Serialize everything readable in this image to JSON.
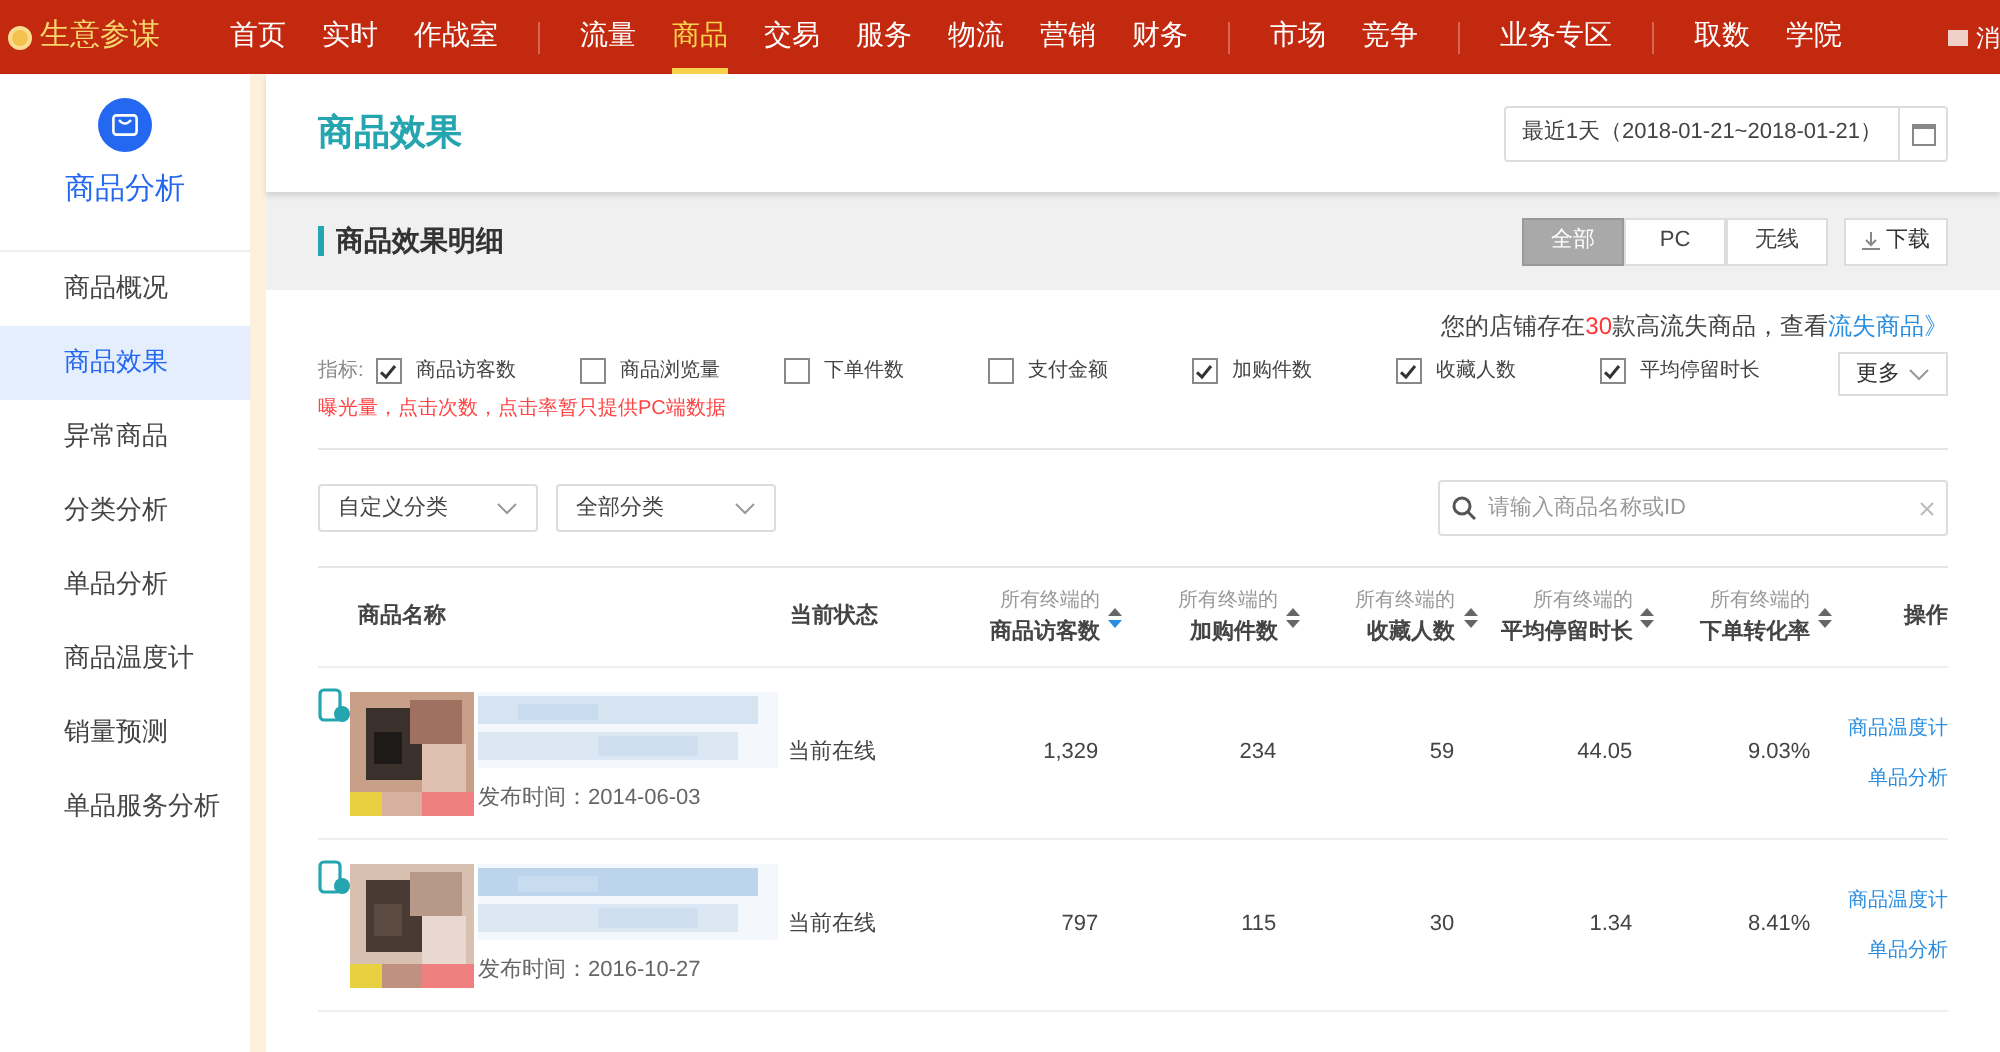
{
  "topnav": {
    "brand": "生意参谋",
    "groups": [
      [
        {
          "label": "首页",
          "selected": false
        },
        {
          "label": "实时",
          "selected": false
        },
        {
          "label": "作战室",
          "selected": false
        }
      ],
      [
        {
          "label": "流量",
          "selected": false
        },
        {
          "label": "商品",
          "selected": true
        },
        {
          "label": "交易",
          "selected": false
        },
        {
          "label": "服务",
          "selected": false
        },
        {
          "label": "物流",
          "selected": false
        },
        {
          "label": "营销",
          "selected": false
        },
        {
          "label": "财务",
          "selected": false
        }
      ],
      [
        {
          "label": "市场",
          "selected": false
        },
        {
          "label": "竞争",
          "selected": false
        }
      ],
      [
        {
          "label": "业务专区",
          "selected": false
        }
      ],
      [
        {
          "label": "取数",
          "selected": false
        },
        {
          "label": "学院",
          "selected": false
        }
      ]
    ],
    "message": "消"
  },
  "sidebar": {
    "title": "商品分析",
    "items": [
      {
        "label": "商品概况",
        "selected": false
      },
      {
        "label": "商品效果",
        "selected": true
      },
      {
        "label": "异常商品",
        "selected": false
      },
      {
        "label": "分类分析",
        "selected": false
      },
      {
        "label": "单品分析",
        "selected": false
      },
      {
        "label": "商品温度计",
        "selected": false
      },
      {
        "label": "销量预测",
        "selected": false
      },
      {
        "label": "单品服务分析",
        "selected": false
      }
    ]
  },
  "page_title": "商品效果",
  "date_range": "最近1天（2018-01-21~2018-01-21）",
  "section": {
    "title": "商品效果明细",
    "terminals": [
      {
        "label": "全部",
        "selected": true
      },
      {
        "label": "PC",
        "selected": false
      },
      {
        "label": "无线",
        "selected": false
      }
    ],
    "download": "下载"
  },
  "notice": {
    "before": "您的店铺存在",
    "count": "30",
    "after": "款高流失商品，查看",
    "link": "流失商品》"
  },
  "metrics": {
    "label": "指标:",
    "items": [
      {
        "label": "商品访客数",
        "checked": true
      },
      {
        "label": "商品浏览量",
        "checked": false
      },
      {
        "label": "下单件数",
        "checked": false
      },
      {
        "label": "支付金额",
        "checked": false
      },
      {
        "label": "加购件数",
        "checked": true
      },
      {
        "label": "收藏人数",
        "checked": true
      },
      {
        "label": "平均停留时长",
        "checked": true
      }
    ],
    "more": "更多",
    "warning": "曝光量，点击次数，点击率暂只提供PC端数据"
  },
  "filters": {
    "dropdowns": [
      "自定义分类",
      "全部分类"
    ],
    "search_placeholder": "请输入商品名称或ID"
  },
  "table": {
    "columns": [
      {
        "title": "商品名称"
      },
      {
        "title": "当前状态"
      },
      {
        "sub": "所有终端的",
        "title": "商品访客数",
        "sorted": true
      },
      {
        "sub": "所有终端的",
        "title": "加购件数",
        "sorted": false
      },
      {
        "sub": "所有终端的",
        "title": "收藏人数",
        "sorted": false
      },
      {
        "sub": "所有终端的",
        "title": "平均停留时长",
        "sorted": false
      },
      {
        "sub": "所有终端的",
        "title": "下单转化率",
        "sorted": false
      },
      {
        "title": "操作"
      }
    ],
    "rows": [
      {
        "published": "发布时间：2014-06-03",
        "status": "当前在线",
        "values": [
          "1,329",
          "234",
          "59",
          "44.05",
          "9.03%"
        ],
        "actions": [
          "商品温度计",
          "单品分析"
        ]
      },
      {
        "published": "发布时间：2016-10-27",
        "status": "当前在线",
        "values": [
          "797",
          "115",
          "30",
          "1.34",
          "8.41%"
        ],
        "actions": [
          "商品温度计",
          "单品分析"
        ]
      }
    ]
  }
}
